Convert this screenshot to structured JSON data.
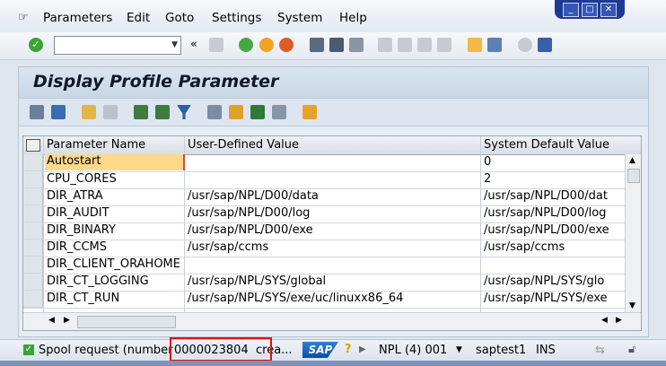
{
  "menu": {
    "items": [
      "Parameters",
      "Edit",
      "Goto",
      "Settings",
      "System",
      "Help"
    ]
  },
  "toolbar": {
    "command_field_value": ""
  },
  "page": {
    "title": "Display Profile Parameter"
  },
  "grid": {
    "columns": [
      "Parameter Name",
      "User-Defined Value",
      "System Default Value"
    ],
    "rows": [
      {
        "name": "Autostart",
        "user": "",
        "default": "0"
      },
      {
        "name": "CPU_CORES",
        "user": "",
        "default": "2"
      },
      {
        "name": "DIR_ATRA",
        "user": "/usr/sap/NPL/D00/data",
        "default": "/usr/sap/NPL/D00/dat"
      },
      {
        "name": "DIR_AUDIT",
        "user": "/usr/sap/NPL/D00/log",
        "default": "/usr/sap/NPL/D00/log"
      },
      {
        "name": "DIR_BINARY",
        "user": "/usr/sap/NPL/D00/exe",
        "default": "/usr/sap/NPL/D00/exe"
      },
      {
        "name": "DIR_CCMS",
        "user": "/usr/sap/ccms",
        "default": "/usr/sap/ccms"
      },
      {
        "name": "DIR_CLIENT_ORAHOME",
        "user": "",
        "default": ""
      },
      {
        "name": "DIR_CT_LOGGING",
        "user": "/usr/sap/NPL/SYS/global",
        "default": "/usr/sap/NPL/SYS/glo"
      },
      {
        "name": "DIR_CT_RUN",
        "user": "/usr/sap/NPL/SYS/exe/uc/linuxx86_64",
        "default": "/usr/sap/NPL/SYS/exe"
      }
    ]
  },
  "status": {
    "message_prefix": "Spool request (number",
    "spool_number": "0000023804",
    "message_suffix": "crea...",
    "sap_logo": "SAP",
    "system": "NPL (4) 001",
    "server": "saptest1",
    "mode": "INS"
  },
  "colors": {
    "accent": "#1f3a93",
    "highlight_border": "#e01010",
    "selected_cell": "#ffd88a"
  },
  "icons": [
    "menu-icon",
    "enter-icon",
    "save-icon",
    "back-icon",
    "exit-icon",
    "cancel-icon",
    "print-icon",
    "find-icon",
    "find-next-icon",
    "first-page-icon",
    "prev-page-icon",
    "next-page-icon",
    "last-page-icon",
    "new-session-icon",
    "shortcut-icon",
    "help-icon",
    "layout-icon",
    "details-icon",
    "filter-icon",
    "sort-ascending-icon",
    "sort-descending-icon",
    "export-icon",
    "layout-grid-icon"
  ]
}
